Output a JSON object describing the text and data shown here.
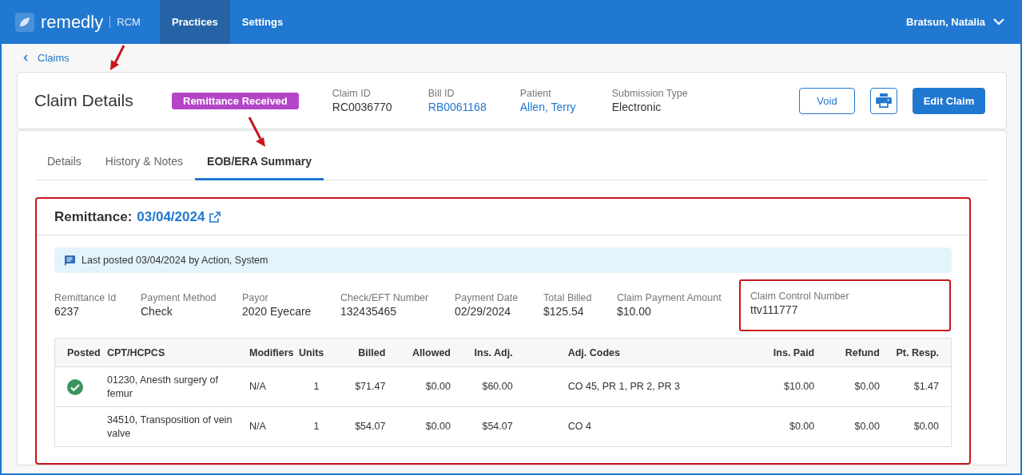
{
  "topbar": {
    "logo_text": "remedly",
    "logo_sub": "RCM",
    "nav": [
      {
        "label": "Practices",
        "selected": true
      },
      {
        "label": "Settings",
        "selected": false
      }
    ],
    "user": "Bratsun, Natalia"
  },
  "breadcrumb": "Claims",
  "claim": {
    "title": "Claim Details",
    "status": "Remittance Received",
    "fields": [
      {
        "label": "Claim ID",
        "value": "RC0036770",
        "kind": "text"
      },
      {
        "label": "Bill ID",
        "value": "RB0061168",
        "kind": "link"
      },
      {
        "label": "Patient",
        "value": "Allen, Terry",
        "kind": "link"
      },
      {
        "label": "Submission Type",
        "value": "Electronic",
        "kind": "text"
      }
    ],
    "buttons": [
      {
        "kind": "outline",
        "label": "Void"
      },
      {
        "kind": "print"
      },
      {
        "kind": "primary",
        "label": "Edit Claim"
      }
    ]
  },
  "tabs": [
    {
      "label": "Details",
      "selected": false
    },
    {
      "label": "History & Notes",
      "selected": false
    },
    {
      "label": "EOB/ERA Summary",
      "selected": true
    }
  ],
  "remittance": {
    "title": "Remittance:",
    "date": "03/04/2024",
    "highlighted": true,
    "notice": "Last posted 03/04/2024 by Action, System",
    "fields": [
      {
        "label": "Remittance Id",
        "value": "6237",
        "highlighted": false
      },
      {
        "label": "Payment Method",
        "value": "Check",
        "highlighted": false
      },
      {
        "label": "Payor",
        "value": "2020 Eyecare",
        "highlighted": false
      },
      {
        "label": "Check/EFT Number",
        "value": "132435465",
        "highlighted": false
      },
      {
        "label": "Payment Date",
        "value": "02/29/2024",
        "highlighted": false
      },
      {
        "label": "Total Billed",
        "value": "$125.54",
        "highlighted": false
      },
      {
        "label": "Claim Payment Amount",
        "value": "$10.00",
        "highlighted": false
      },
      {
        "label": "Claim Control Number",
        "value": "ttv111777",
        "highlighted": true
      }
    ],
    "table": {
      "columns": [
        "Posted",
        "CPT/HCPCS",
        "Modifiers",
        "Units",
        "Billed",
        "Allowed",
        "Ins. Adj.",
        "Adj. Codes",
        "Ins. Paid",
        "Refund",
        "Pt. Resp."
      ],
      "rows": [
        {
          "posted": true,
          "cells": [
            "",
            "01230, Anesth surgery of femur",
            "N/A",
            "1",
            "$71.47",
            "$0.00",
            "$60.00",
            "CO 45, PR 1, PR 2, PR 3",
            "$10.00",
            "$0.00",
            "$1.47"
          ]
        },
        {
          "posted": false,
          "cells": [
            "",
            "34510, Transposition of vein valve",
            "N/A",
            "1",
            "$54.07",
            "$0.00",
            "$54.07",
            "CO 4",
            "$0.00",
            "$0.00",
            "$0.00"
          ]
        }
      ]
    }
  }
}
